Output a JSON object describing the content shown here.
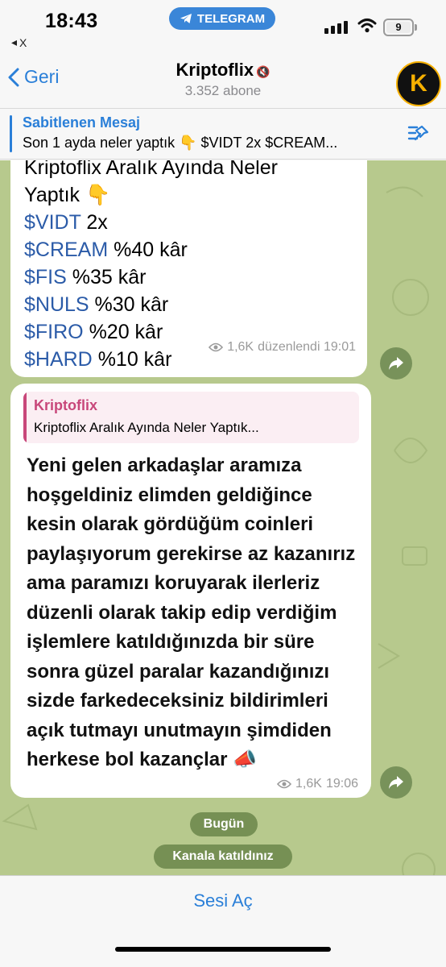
{
  "status_bar": {
    "time": "18:43",
    "back_app_label": "X",
    "app_pill": "TELEGRAM",
    "battery": "9"
  },
  "header": {
    "back_label": "Geri",
    "title": "Kriptoflix",
    "subtitle": "3.352 abone",
    "avatar_letter": "K"
  },
  "pinned": {
    "title": "Sabitlenen Mesaj",
    "text": "Son 1 ayda neler yaptık 👇 $VIDT 2x $CREAM..."
  },
  "messages": [
    {
      "lines": [
        {
          "ticker": "",
          "text": "Kriptoflix Aralık Ayında Neler"
        },
        {
          "ticker": "",
          "text": "Yaptık 👇"
        },
        {
          "ticker": "$VIDT",
          "text": " 2x"
        },
        {
          "ticker": "$CREAM",
          "text": " %40 kâr"
        },
        {
          "ticker": "$FIS",
          "text": " %35 kâr"
        },
        {
          "ticker": "$NULS",
          "text": " %30 kâr"
        },
        {
          "ticker": "$FIRO",
          "text": " %20 kâr"
        },
        {
          "ticker": "$HARD",
          "text": " %10 kâr"
        }
      ],
      "views": "1,6K",
      "meta": "düzenlendi 19:01"
    },
    {
      "reply_name": "Kriptoflix",
      "reply_text": "Kriptoflix Aralık Ayında Neler Yaptık...",
      "body": "Yeni gelen arkadaşlar aramıza hoşgeldiniz elimden geldiğince kesin olarak gördüğüm coinleri paylaşıyorum gerekirse az kazanırız ama paramızı koruyarak ilerleriz düzenli olarak takip edip verdiğim işlemlere katıldığınızda bir süre sonra güzel paralar kazandığınızı sizde farkedeceksiniz bildirimleri açık tutmayı unutmayın şimdiden herkese bol kazançlar 📣",
      "views": "1,6K",
      "meta": "19:06"
    }
  ],
  "date_pill": "Bugün",
  "service_pill": "Kanala katıldınız",
  "bottom": {
    "action": "Sesi Aç"
  },
  "colors": {
    "accent": "#2a7fd8",
    "reply_accent": "#c8477a",
    "chat_bg": "#b7c98d"
  }
}
